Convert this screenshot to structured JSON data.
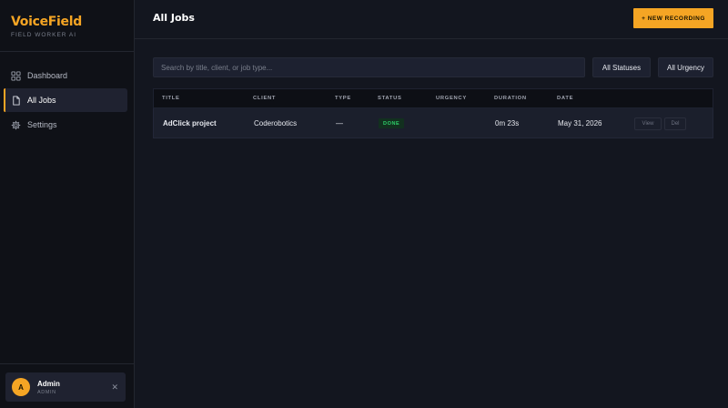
{
  "brand": {
    "name": "VoiceField",
    "subtitle": "FIELD WORKER AI"
  },
  "colors": {
    "accent": "#f5a524",
    "background": "#13161f",
    "sidebar": "#0f1117",
    "done": "#2fcf6a"
  },
  "sidebar": {
    "items": [
      {
        "label": "Dashboard",
        "icon": "grid-icon",
        "active": false
      },
      {
        "label": "All Jobs",
        "icon": "document-icon",
        "active": true
      },
      {
        "label": "Settings",
        "icon": "gear-icon",
        "active": false
      }
    ]
  },
  "user": {
    "initial": "A",
    "name": "Admin",
    "role": "ADMIN",
    "logout_icon": "close-icon"
  },
  "header": {
    "title": "All Jobs",
    "new_button": "+ NEW RECORDING"
  },
  "filters": {
    "search_placeholder": "Search by title, client, or job type...",
    "status": "All Statuses",
    "urgency": "All Urgency"
  },
  "table": {
    "columns": [
      "TITLE",
      "CLIENT",
      "TYPE",
      "STATUS",
      "URGENCY",
      "DURATION",
      "DATE"
    ],
    "rows": [
      {
        "title": "AdClick project",
        "client": "Coderobotics",
        "type": "—",
        "status": "DONE",
        "urgency": "",
        "duration": "0m 23s",
        "date": "May 31, 2026",
        "view": "View",
        "delete": "Del"
      }
    ]
  }
}
